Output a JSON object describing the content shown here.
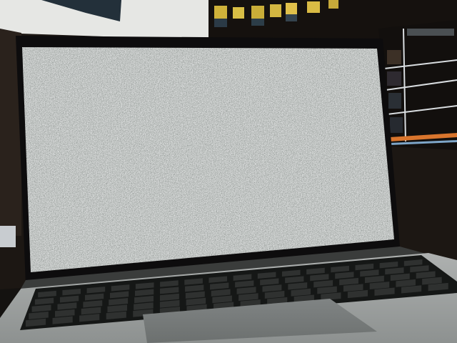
{
  "scene": {
    "subject": "laptop",
    "screen_state": "static-noise",
    "colors": {
      "wall_white": "#e6e7e4",
      "wall_dark": "#1c1713",
      "shelf_dark": "#15110e",
      "shelf_orange": "#d9752d",
      "bezel": "#0d0c0d",
      "deck": "#9da09f",
      "keyboard": "#151716",
      "keycap": "#2f3130",
      "touchpad": "#777b7b",
      "noise_light": "#d4d8d5",
      "noise_dark": "#3b3f3e"
    }
  }
}
